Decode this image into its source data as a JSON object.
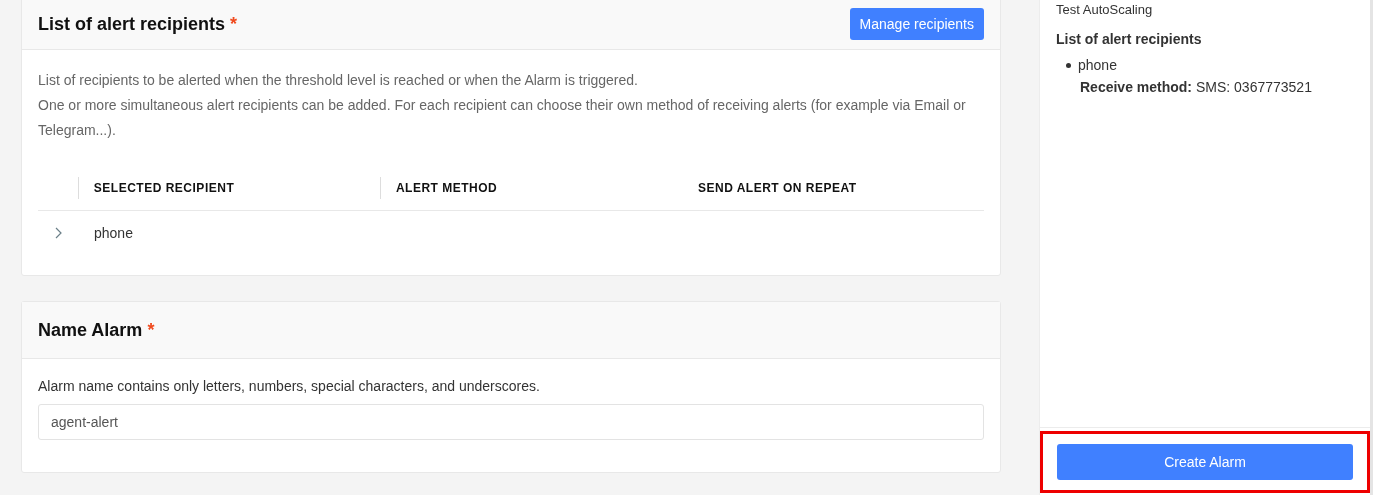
{
  "recipients_card": {
    "title": "List of alert recipients",
    "required_mark": "*",
    "manage_button": "Manage recipients",
    "description": [
      "List of recipients to be alerted when the threshold level is reached or when the Alarm is triggered.",
      "One or more simultaneous alert recipients can be added. For each recipient can choose their own method of receiving alerts (for example via Email or Telegram...)."
    ],
    "table": {
      "columns": [
        "SELECTED RECIPIENT",
        "ALERT METHOD",
        "SEND ALERT ON REPEAT"
      ],
      "rows": [
        {
          "recipient": "phone",
          "expanded": false
        }
      ]
    }
  },
  "name_card": {
    "title": "Name Alarm",
    "required_mark": "*",
    "hint": "Alarm name contains only letters, numbers, special characters, and underscores.",
    "value": "agent-alert"
  },
  "summary": {
    "name": "Test AutoScaling",
    "recipients_heading": "List of alert recipients",
    "recipients": [
      {
        "name": "phone",
        "method_label": "Receive method:",
        "method_value": "SMS: 0367773521"
      }
    ],
    "create_button": "Create Alarm",
    "highlighted": true
  }
}
